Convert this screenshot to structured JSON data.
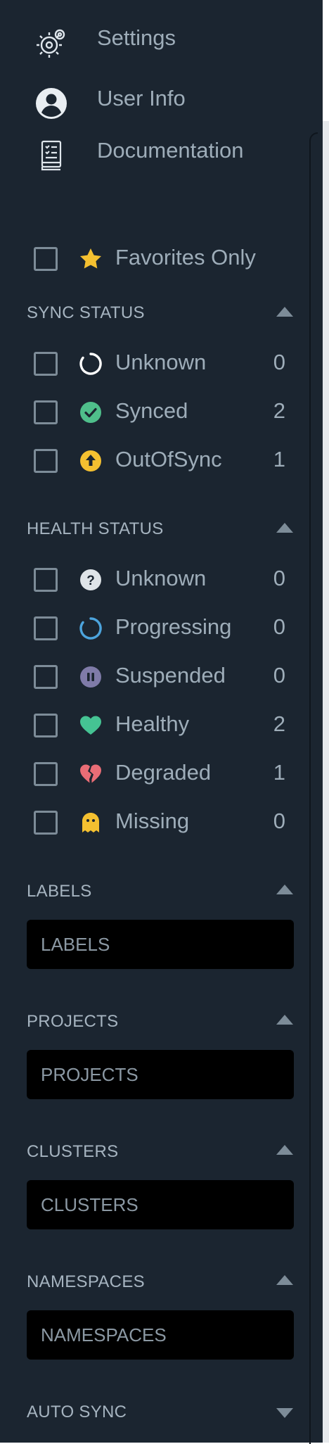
{
  "nav": {
    "settings": "Settings",
    "user_info": "User Info",
    "documentation": "Documentation"
  },
  "favorites": {
    "label": "Favorites Only"
  },
  "sync_status": {
    "title": "SYNC STATUS",
    "items": [
      {
        "label": "Unknown",
        "count": "0",
        "icon": "circle-notch-icon",
        "color": "#ffffff"
      },
      {
        "label": "Synced",
        "count": "2",
        "icon": "check-circle-icon",
        "color": "#4fbf8b"
      },
      {
        "label": "OutOfSync",
        "count": "1",
        "icon": "arrow-up-circle-icon",
        "color": "#f4c030"
      }
    ]
  },
  "health_status": {
    "title": "HEALTH STATUS",
    "items": [
      {
        "label": "Unknown",
        "count": "0",
        "icon": "question-circle-icon",
        "color": "#dfe4e8"
      },
      {
        "label": "Progressing",
        "count": "0",
        "icon": "spinner-icon",
        "color": "#4ca4dd"
      },
      {
        "label": "Suspended",
        "count": "0",
        "icon": "pause-circle-icon",
        "color": "#7f7ba8"
      },
      {
        "label": "Healthy",
        "count": "2",
        "icon": "heart-icon",
        "color": "#45c393"
      },
      {
        "label": "Degraded",
        "count": "1",
        "icon": "heart-broken-icon",
        "color": "#e96d76"
      },
      {
        "label": "Missing",
        "count": "0",
        "icon": "ghost-icon",
        "color": "#f4c030"
      }
    ]
  },
  "labels": {
    "title": "LABELS",
    "placeholder": "LABELS"
  },
  "projects": {
    "title": "PROJECTS",
    "placeholder": "PROJECTS"
  },
  "clusters": {
    "title": "CLUSTERS",
    "placeholder": "CLUSTERS"
  },
  "namespaces": {
    "title": "NAMESPACES",
    "placeholder": "NAMESPACES"
  },
  "auto_sync": {
    "title": "AUTO SYNC"
  },
  "colors": {
    "panel": "#1b2530",
    "text": "#9eadb9",
    "input_bg": "#000000",
    "star": "#f4c030"
  }
}
